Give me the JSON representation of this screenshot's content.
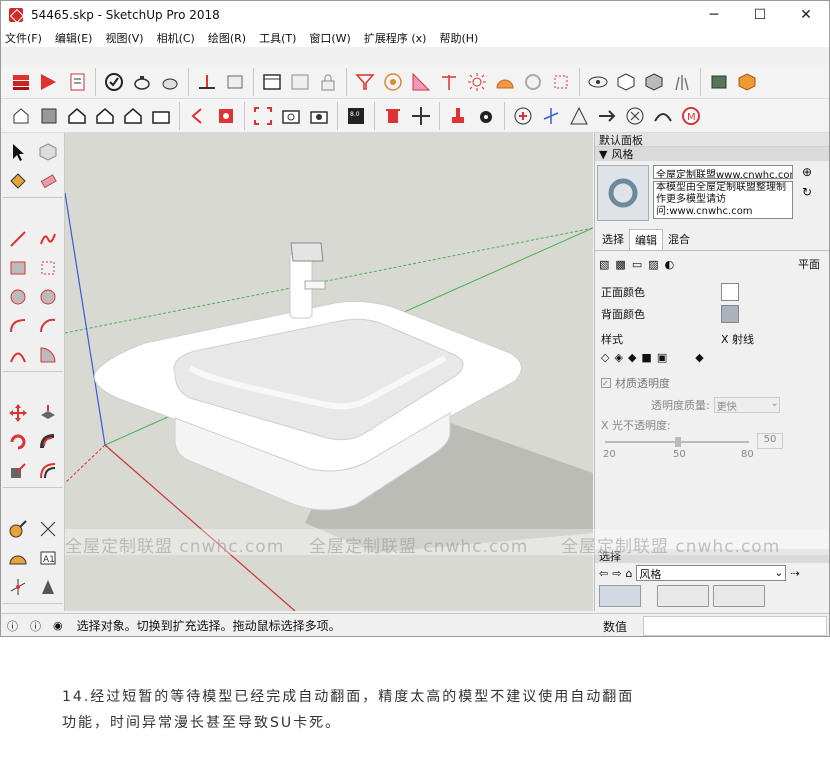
{
  "window": {
    "title": "54465.skp - SketchUp Pro 2018",
    "controls": [
      "─",
      "☐",
      "✕"
    ]
  },
  "menu": [
    "文件(F)",
    "编辑(E)",
    "视图(V)",
    "相机(C)",
    "绘图(R)",
    "工具(T)",
    "窗口(W)",
    "扩展程序 (x)",
    "帮助(H)"
  ],
  "panel": {
    "title": "默认面板",
    "section": "风格",
    "style_name": "全屋定制联盟www.cnwhc.com",
    "description": "本模型由全屋定制联盟整理制作更多模型请访问:www.cnwhc.com",
    "tabs": [
      "选择",
      "编辑",
      "混合"
    ],
    "active_tab": "编辑",
    "mode_label": "平面",
    "front_color_label": "正面颜色",
    "back_color_label": "背面颜色",
    "style_label": "样式",
    "xray_label": "X 射线",
    "transparency_label": "材质透明度",
    "quality_label": "透明度质量:",
    "quality_value": "更快",
    "opacity_label": "X 光不透明度:",
    "opacity_value": "50",
    "ticks": [
      "20",
      "50",
      "80"
    ],
    "select_header": "选择",
    "select_dropdown": "风格",
    "colors": {
      "front": "#ffffff",
      "back": "#a9b3bc"
    }
  },
  "status": {
    "text": "选择对象。切换到扩充选择。拖动鼠标选择多项。",
    "measure_label": "数值"
  },
  "watermark": [
    "全屋定制联盟 cnwhc.com",
    "全屋定制联盟 cnwhc.com",
    "全屋定制联盟 cnwhc.com"
  ],
  "caption": {
    "line1": "14.经过短暂的等待模型已经完成自动翻面，精度太高的模型不建议使用自动翻面",
    "line2": "功能，时间异常漫长甚至导致SU卡死。"
  }
}
